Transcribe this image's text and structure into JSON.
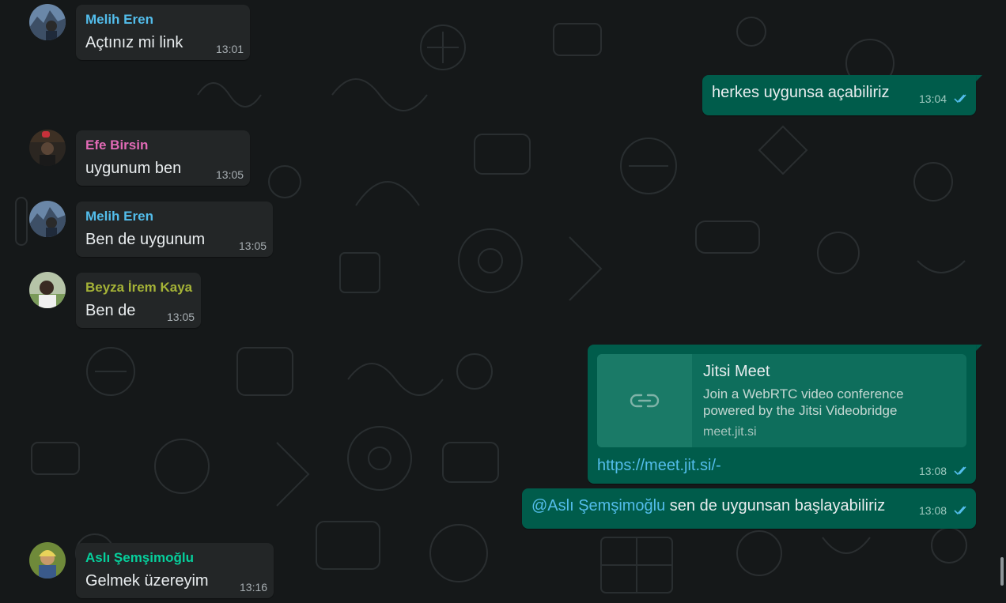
{
  "colors": {
    "background": "#151819",
    "incoming_bubble": "#232627",
    "outgoing_bubble": "#005c4b",
    "read_ticks": "#53bdeb",
    "mention": "#53bdeb"
  },
  "messages": [
    {
      "sender": "Melih Eren",
      "sender_color": "#53bdeb",
      "text": "Açtınız mi link",
      "time": "13:01"
    },
    {
      "text": "herkes uygunsa açabiliriz",
      "time": "13:04",
      "status": "read"
    },
    {
      "sender": "Efe Birsin",
      "sender_color": "#e26ab6",
      "text": "uygunum ben",
      "time": "13:05"
    },
    {
      "sender": "Melih Eren",
      "sender_color": "#53bdeb",
      "text": "Ben de uygunum",
      "time": "13:05"
    },
    {
      "sender": "Beyza İrem Kaya",
      "sender_color": "#a5b337",
      "text": "Ben de",
      "time": "13:05"
    },
    {
      "link_preview": {
        "title": "Jitsi Meet",
        "description": "Join a WebRTC video conference powered by the Jitsi Videobridge",
        "domain": "meet.jit.si",
        "icon": "link-icon"
      },
      "text": "https://meet.jit.si/-",
      "time": "13:08",
      "status": "read"
    },
    {
      "mention": "@Aslı Şemşimoğlu",
      "text": " sen de uygunsan başlayabiliriz",
      "time": "13:08",
      "status": "read"
    },
    {
      "sender": "Aslı Şemşimoğlu",
      "sender_color": "#06cf9c",
      "text": "Gelmek üzereyim",
      "time": "13:16"
    }
  ]
}
